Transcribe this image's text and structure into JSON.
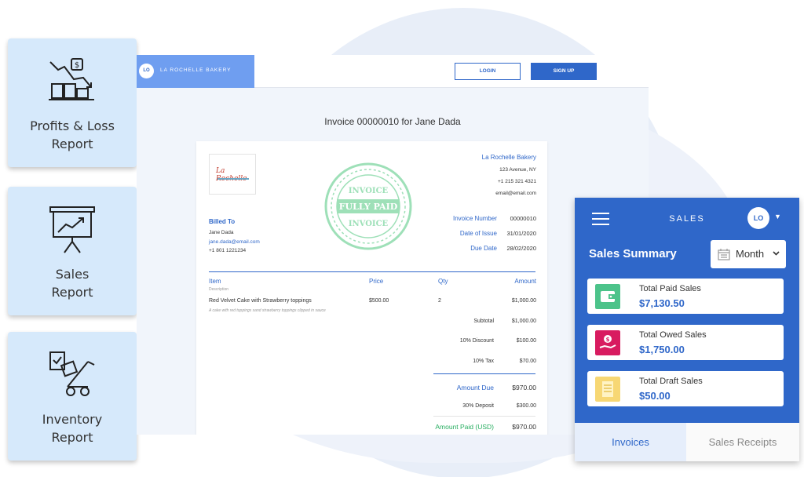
{
  "colors": {
    "accent": "#2f67c9",
    "card_bg": "#d6e9fb",
    "paid_green": "#9ee0b8",
    "owed_pink": "#d81b60",
    "paid_tile": "#4cc38a",
    "draft_tile": "#f7d774",
    "amount_paid_green": "#27ae60"
  },
  "reports": [
    {
      "icon": "profit-loss-icon",
      "label_line1": "Profits & Loss",
      "label_line2": "Report"
    },
    {
      "icon": "presentation-chart-icon",
      "label_line1": "Sales",
      "label_line2": "Report"
    },
    {
      "icon": "inventory-cart-icon",
      "label_line1": "Inventory",
      "label_line2": "Report"
    }
  ],
  "topbar": {
    "logo_initials": "LO",
    "brand_name": "LA ROCHELLE BAKERY",
    "login_label": "LOGIN",
    "signup_label": "SIGN UP"
  },
  "invoice": {
    "title": "Invoice 00000010 for Jane Dada",
    "company": {
      "name": "La Rochelle Bakery",
      "address": "123 Avenue, NY",
      "phone": "+1 215 321 4321",
      "email": "email@email.com"
    },
    "logo_text": "La Rochelle",
    "billed_to": {
      "heading": "Billed To",
      "name": "Jane Dada",
      "email": "jane.dada@email.com",
      "phone": "+1 801 1221234"
    },
    "meta": {
      "invoice_number_label": "Invoice Number",
      "invoice_number": "00000010",
      "date_of_issue_label": "Date of Issue",
      "date_of_issue": "31/01/2020",
      "due_date_label": "Due Date",
      "due_date": "28/02/2020"
    },
    "stamp": {
      "top": "INVOICE",
      "middle": "FULLY PAID",
      "bottom": "INVOICE"
    },
    "columns": {
      "item": "Item",
      "item_sub": "Description",
      "price": "Price",
      "qty": "Qty",
      "amount": "Amount"
    },
    "line": {
      "item": "Red Velvet Cake with Strawberry toppings",
      "description": "A cake with red toppings sand strawberry toppings clipped in sauce",
      "price": "$500.00",
      "qty": "2",
      "amount": "$1,000.00"
    },
    "totals": {
      "subtotal_label": "Subtotal",
      "subtotal": "$1,000.00",
      "discount_label": "10% Discount",
      "discount": "$100.00",
      "tax_label": "10% Tax",
      "tax": "$70.00",
      "amount_due_label": "Amount Due",
      "amount_due": "$970.00",
      "deposit_label": "30% Deposit",
      "deposit": "$300.00",
      "amount_paid_label": "Amount Paid (USD)",
      "amount_paid": "$970.00"
    }
  },
  "sales": {
    "header_title": "SALES",
    "avatar_initials": "LO",
    "summary_title": "Sales  Summary",
    "period": "Month",
    "stats": [
      {
        "icon": "wallet-icon",
        "label": "Total Paid Sales",
        "value": "$7,130.50"
      },
      {
        "icon": "hand-coin-icon",
        "label": "Total Owed Sales",
        "value": "$1,750.00"
      },
      {
        "icon": "document-icon",
        "label": "Total Draft Sales",
        "value": "$50.00"
      }
    ],
    "tabs": [
      "Invoices",
      "Sales Receipts"
    ]
  }
}
